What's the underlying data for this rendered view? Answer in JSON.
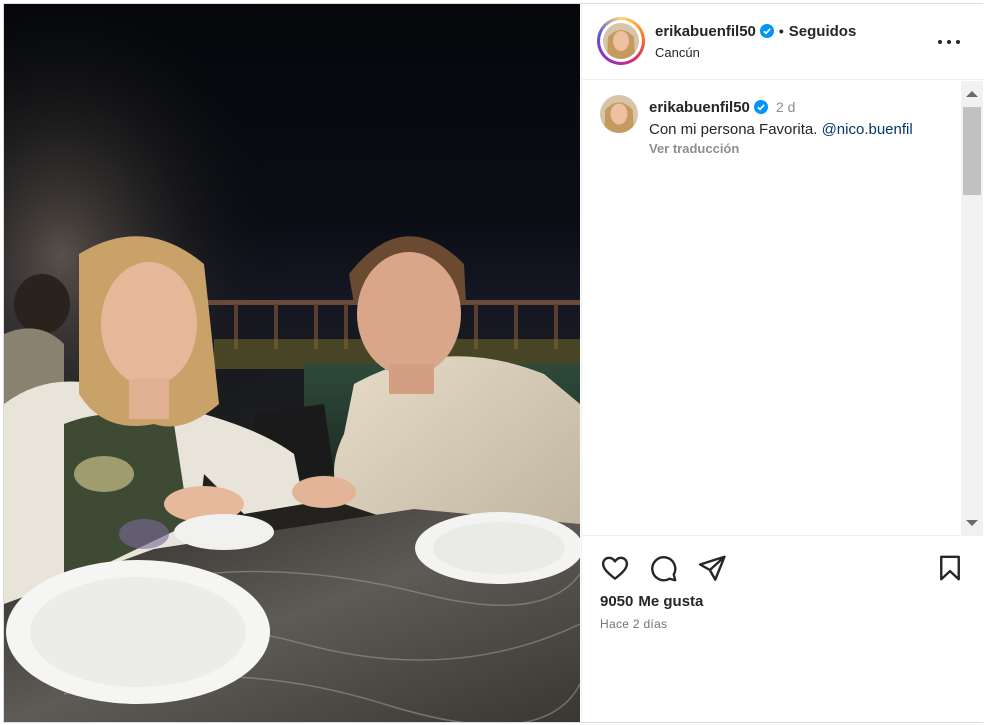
{
  "post": {
    "username": "erikabuenfil50",
    "follow_status": "Seguidos",
    "location": "Cancún",
    "verified": true
  },
  "caption": {
    "username": "erikabuenfil50",
    "time": "2 d",
    "text": "Con mi persona Favorita.",
    "mention": "@nico.buenfil",
    "translate_label": "Ver traducción"
  },
  "stats": {
    "likes_count": "9050",
    "likes_label": "Me gusta",
    "posted_ago": "Hace 2 días"
  },
  "icons": {
    "like": "heart-icon",
    "comment": "comment-icon",
    "share": "share-icon",
    "save": "bookmark-icon",
    "more": "more-options-icon",
    "verified": "verified-badge-icon"
  },
  "colors": {
    "verified_blue": "#0095f6",
    "mention": "#00376b",
    "muted": "#8e8e8e"
  }
}
